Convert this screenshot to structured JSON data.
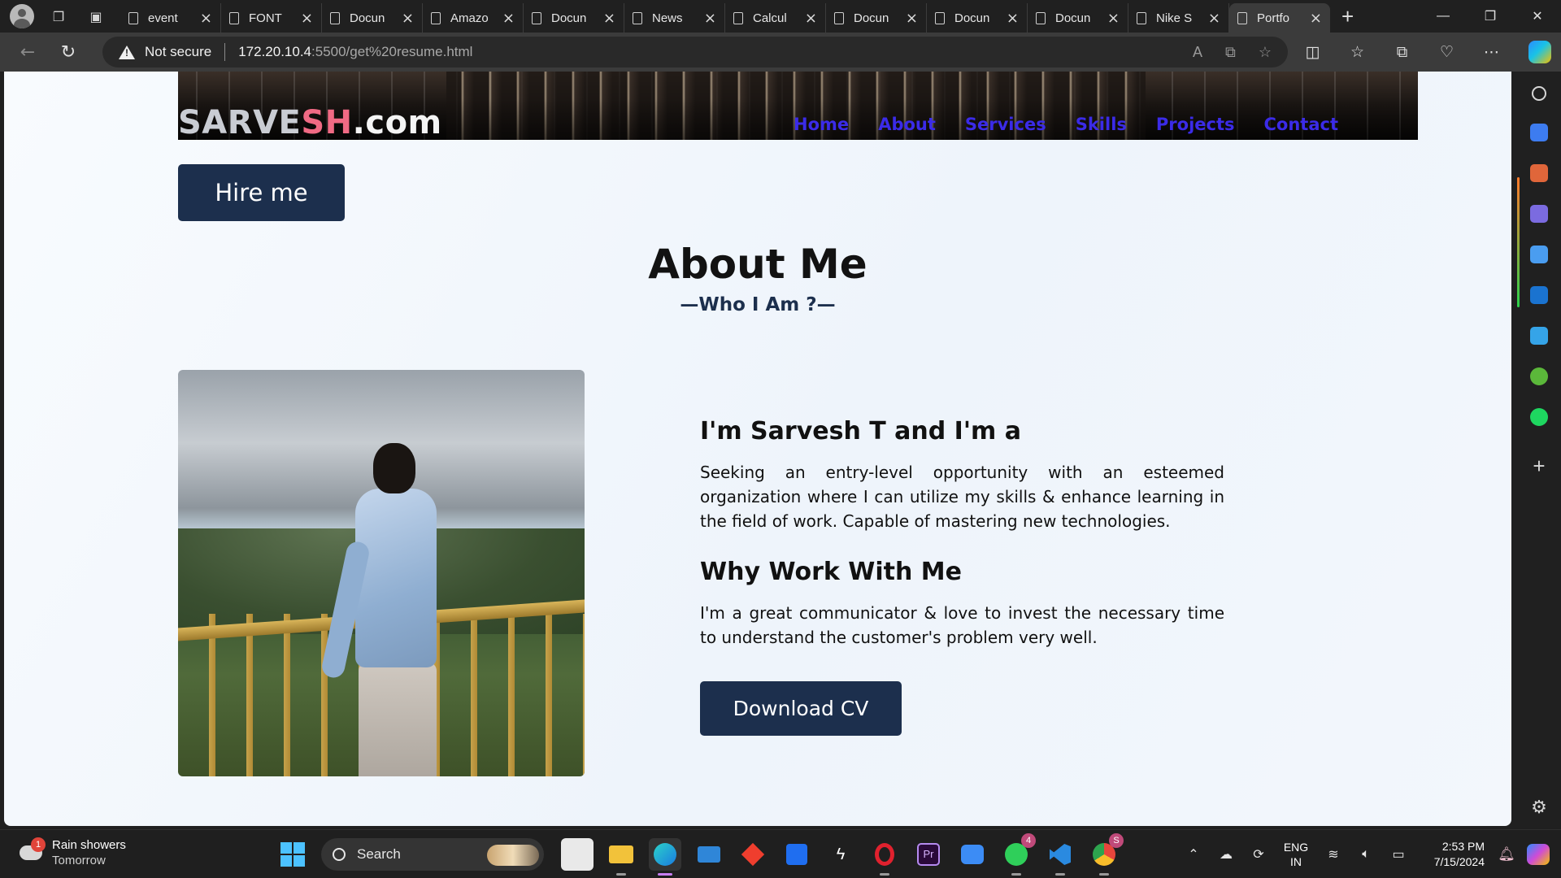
{
  "browser": {
    "tabs": [
      {
        "label": "event"
      },
      {
        "label": "FONT"
      },
      {
        "label": "Docun"
      },
      {
        "label": "Amazo"
      },
      {
        "label": "Docun"
      },
      {
        "label": "News"
      },
      {
        "label": "Calcul"
      },
      {
        "label": "Docun"
      },
      {
        "label": "Docun"
      },
      {
        "label": "Docun"
      },
      {
        "label": "Nike S"
      },
      {
        "label": "Portfo",
        "active": true
      }
    ],
    "security_label": "Not secure",
    "url_host": "172.20.10.4",
    "url_path": ":5500/get%20resume.html"
  },
  "site": {
    "logo_part1": "SARVE",
    "logo_part2": "SH",
    "logo_part3": ".com",
    "nav": [
      "Home",
      "About",
      "Services",
      "Skills",
      "Projects",
      "Contact"
    ],
    "hire_button": "Hire me",
    "section_title": "About Me",
    "section_subtitle": "—Who I Am ?—",
    "intro_heading": "I'm Sarvesh T and I'm a",
    "intro_text": "Seeking an entry-level opportunity with an esteemed organization where I can utilize my skills & enhance learning in the field of work. Capable of mastering new technologies.",
    "why_heading": "Why Work With Me",
    "why_text": "I'm a great communicator & love to invest the necessary time to understand the customer's problem very well.",
    "download_button": "Download CV"
  },
  "taskbar": {
    "weather_badge": "1",
    "weather_line1": "Rain showers",
    "weather_line2": "Tomorrow",
    "search_label": "Search",
    "whatsapp_badge": "4",
    "chrome_badge": "S",
    "lang_line1": "ENG",
    "lang_line2": "IN",
    "time": "2:53 PM",
    "date": "7/15/2024"
  },
  "colors": {
    "accent_navy": "#1c2f4d",
    "nav_link": "#3b2be8",
    "logo_pink": "#f06a84"
  }
}
